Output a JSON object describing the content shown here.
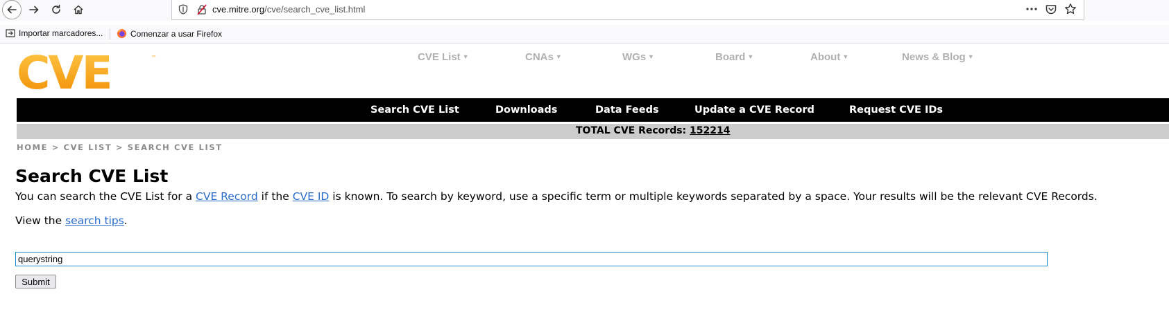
{
  "browser": {
    "url_host": "cve.mitre.org",
    "url_path": "/cve/search_cve_list.html",
    "bookmarks": [
      "Importar marcadores...",
      "Comenzar a usar Firefox"
    ]
  },
  "header": {
    "logo_text": "CVE",
    "logo_tm": "™",
    "top_nav": [
      "CVE List",
      "CNAs",
      "WGs",
      "Board",
      "About",
      "News & Blog"
    ],
    "sub_nav": [
      "Search CVE List",
      "Downloads",
      "Data Feeds",
      "Update a CVE Record",
      "Request CVE IDs"
    ],
    "total_label": "TOTAL CVE Records:",
    "total_count": "152214"
  },
  "breadcrumb": {
    "home": "HOME",
    "sep": ">",
    "cve_list": "CVE LIST",
    "current": "SEARCH CVE LIST"
  },
  "main": {
    "title": "Search CVE List",
    "intro_1": "You can search the CVE List for a ",
    "intro_link_1": "CVE Record",
    "intro_2": " if the ",
    "intro_link_2": "CVE ID",
    "intro_3": " is known. To search by keyword, use a specific term or multiple keywords separated by a space. Your results will be the relevant CVE Records.",
    "tips_1": "View the ",
    "tips_link": "search tips",
    "tips_2": ".",
    "search_value": "querystring",
    "submit_label": "Submit"
  },
  "colors": {
    "logo_orange": "#f7a51e",
    "nav_gray": "#b0b0b0",
    "bar_black": "#000000",
    "total_bar_gray": "#cccccc",
    "link_blue": "#2a6ccd",
    "input_border": "#1b8bd0"
  },
  "icons": [
    "back-icon",
    "forward-icon",
    "reload-icon",
    "home-icon",
    "shield-icon",
    "insecure-lock-icon",
    "reader-view-icon",
    "more-icon",
    "pocket-icon",
    "bookmark-star-icon",
    "import-icon",
    "firefox-icon"
  ]
}
